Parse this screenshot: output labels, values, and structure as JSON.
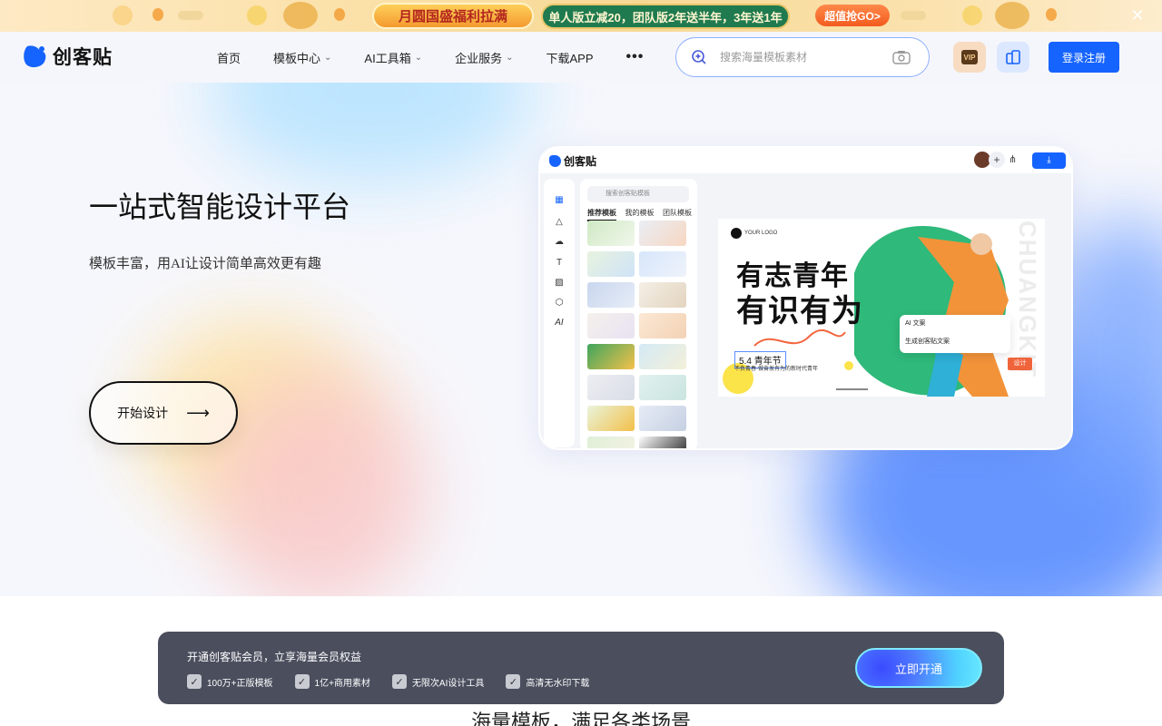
{
  "promo": {
    "pill1": "月圆国盛福利拉满",
    "pill2": "单人版立减20，团队版2年送半年，3年送1年",
    "pill3": "超值抢GO>",
    "close_glyph": "✕"
  },
  "nav": {
    "logo_text": "创客贴",
    "menu": [
      {
        "label": "首页",
        "chevron": false
      },
      {
        "label": "模板中心",
        "chevron": true
      },
      {
        "label": "AI工具箱",
        "chevron": true
      },
      {
        "label": "企业服务",
        "chevron": true
      },
      {
        "label": "下载APP",
        "chevron": false
      }
    ],
    "more_glyph": "•••",
    "chevron_glyph": "⌄",
    "search_placeholder": "搜索海量模板素材",
    "vip_label": "VIP",
    "login_label": "登录注册"
  },
  "hero": {
    "title": "一站式智能设计平台",
    "subtitle": "模板丰富，用AI让设计简单高效更有趣",
    "cta_label": "开始设计",
    "cta_arrow": "⟶"
  },
  "mock": {
    "logo_text": "创客贴",
    "plus": "+",
    "share": "⋔",
    "download": "⤓",
    "search_placeholder": "搜索创客贴模板",
    "tabs": [
      "推荐模板",
      "我的模板",
      "团队模板"
    ],
    "rail_icons": [
      "▦",
      "△",
      "☁",
      "T",
      "▨",
      "⬡",
      "AI"
    ],
    "canvas": {
      "logo": "YOUR LOGO",
      "title1": "有志青年",
      "title2": "有识有为",
      "date": "5.4 青年节",
      "small": "不负青春·做奋发有为的新时代青年",
      "vertical": "CHUANGKIT",
      "ai_head": "AI 文案",
      "ai_body": "生成创客贴文案",
      "design_tag": "设计"
    }
  },
  "bottom": {
    "bar_title": "开通创客贴会员，立享海量会员权益",
    "benefits": [
      "100万+正版模板",
      "1亿+商用素材",
      "无限次AI设计工具",
      "高清无水印下载"
    ],
    "check_glyph": "✓",
    "open_label": "立即开通",
    "section_title": "海量模板，满足各类场景"
  },
  "colors": {
    "brand": "#1664ff",
    "promo_bar_bg": "#4a4e5d"
  }
}
